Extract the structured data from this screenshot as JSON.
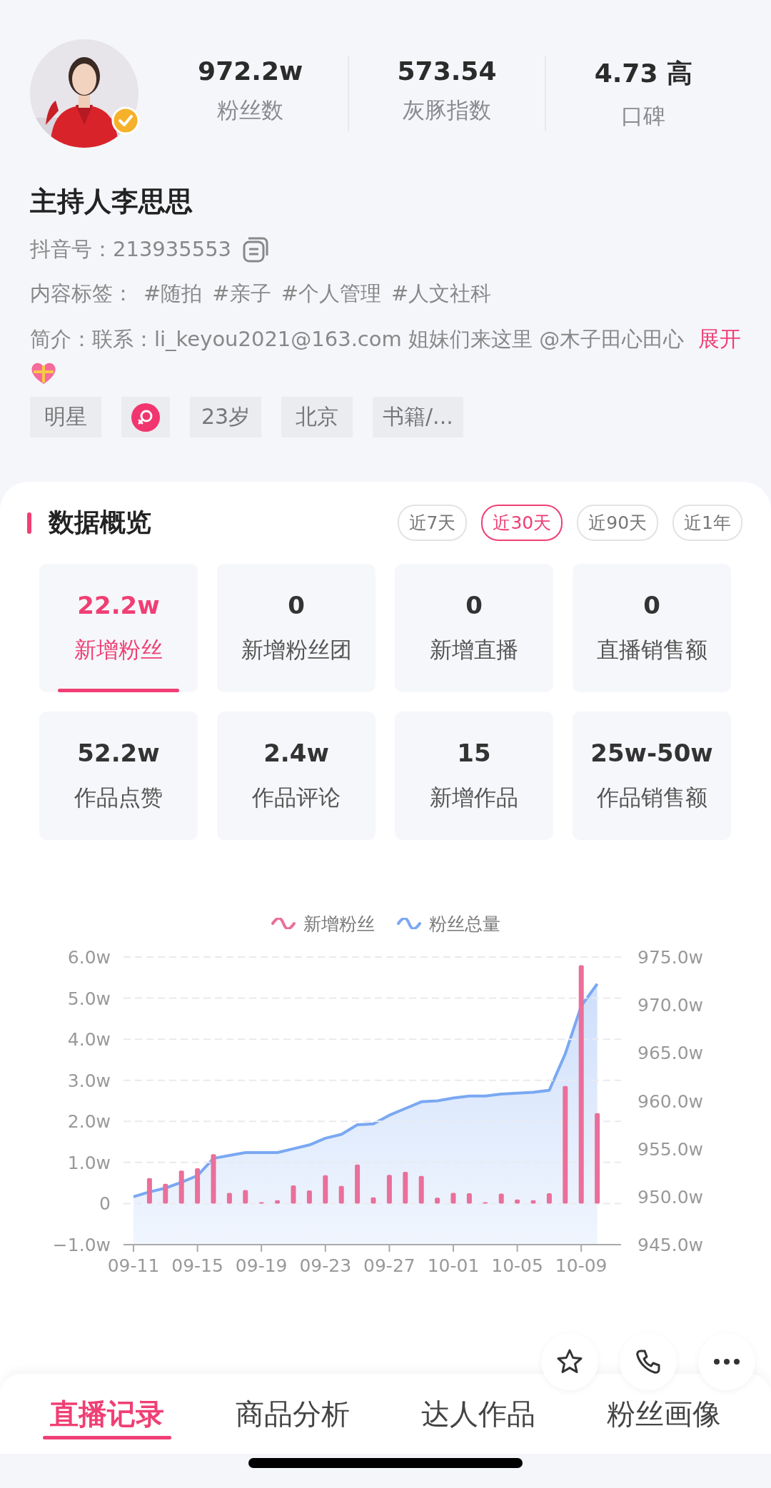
{
  "profile": {
    "stats": [
      {
        "value": "972.2w",
        "label": "粉丝数"
      },
      {
        "value": "573.54",
        "label": "灰豚指数"
      },
      {
        "value": "4.73 高",
        "label": "口碑"
      }
    ],
    "name": "主持人李思思",
    "douyin_id": {
      "label": "抖音号：",
      "value": "213935553"
    },
    "content_tags": {
      "label": "内容标签：",
      "tags": [
        "#随拍",
        "#亲子",
        "#个人管理",
        "#人文社科"
      ]
    },
    "bio": {
      "text": "简介：联系：li_keyou2021@163.com 姐妹们来这里 @木子田心田心",
      "expand": "展开"
    },
    "chips": [
      {
        "kind": "text",
        "label": "明星"
      },
      {
        "kind": "gender"
      },
      {
        "kind": "text",
        "label": "23岁"
      },
      {
        "kind": "text",
        "label": "北京"
      },
      {
        "kind": "text",
        "label": "书籍/..."
      }
    ]
  },
  "overview": {
    "title": "数据概览",
    "periods": [
      {
        "label": "近7天",
        "selected": false
      },
      {
        "label": "近30天",
        "selected": true
      },
      {
        "label": "近90天",
        "selected": false
      },
      {
        "label": "近1年",
        "selected": false
      }
    ],
    "metrics": [
      {
        "value": "22.2w",
        "label": "新增粉丝",
        "selected": true
      },
      {
        "value": "0",
        "label": "新增粉丝团",
        "selected": false
      },
      {
        "value": "0",
        "label": "新增直播",
        "selected": false
      },
      {
        "value": "0",
        "label": "直播销售额",
        "selected": false
      },
      {
        "value": "52.2w",
        "label": "作品点赞",
        "selected": false
      },
      {
        "value": "2.4w",
        "label": "作品评论",
        "selected": false
      },
      {
        "value": "15",
        "label": "新增作品",
        "selected": false
      },
      {
        "value": "25w-50w",
        "label": "作品销售额",
        "selected": false
      }
    ],
    "chart_layers": [
      {
        "chart_data": {
          "type": "bar",
          "categories": [
            "09-11",
            null,
            null,
            null,
            "09-15",
            null,
            null,
            null,
            "09-19",
            null,
            null,
            null,
            "09-23",
            null,
            null,
            null,
            "09-27",
            null,
            null,
            null,
            "10-01",
            null,
            null,
            null,
            "10-05",
            null,
            null,
            null,
            "10-09",
            null
          ],
          "grid": true,
          "legend": true,
          "ylim": [
            -1,
            6
          ],
          "yticks": [
            {
              "value": 6,
              "label": "6.0w"
            },
            {
              "value": 5,
              "label": "5.0w"
            },
            {
              "value": 4,
              "label": "4.0w"
            },
            {
              "value": 3,
              "label": "3.0w"
            },
            {
              "value": 2,
              "label": "2.0w"
            },
            {
              "value": 1,
              "label": "1.0w"
            },
            {
              "value": 0,
              "label": "0"
            },
            {
              "value": -1,
              "label": "−1.0w"
            }
          ],
          "series": [
            {
              "name": "新增粉丝",
              "color": "#ea6f9a",
              "values": [
                null,
                0.62,
                0.48,
                0.8,
                0.86,
                1.2,
                0.26,
                0.33,
                0,
                0.08,
                0.44,
                0.32,
                0.69,
                0.43,
                0.95,
                0.15,
                0.7,
                0.77,
                0.67,
                0.14,
                0.26,
                0.25,
                0.03,
                0.24,
                0.1,
                0.08,
                0.25,
                2.86,
                5.8,
                2.2
              ]
            }
          ]
        }
      },
      {
        "chart_data": {
          "type": "area",
          "legend": true,
          "ylim": [
            945,
            975
          ],
          "yticks": [
            {
              "value": 975,
              "label": "975.0w"
            },
            {
              "value": 970,
              "label": "970.0w"
            },
            {
              "value": 965,
              "label": "965.0w"
            },
            {
              "value": 960,
              "label": "960.0w"
            },
            {
              "value": 955,
              "label": "955.0w"
            },
            {
              "value": 950,
              "label": "950.0w"
            },
            {
              "value": 945,
              "label": "945.0w"
            }
          ],
          "series": [
            {
              "name": "粉丝总量",
              "color": "#7aa8f2",
              "values": [
                950.0,
                950.5,
                950.9,
                951.5,
                952.2,
                954.0,
                954.3,
                954.6,
                954.6,
                954.6,
                955.0,
                955.4,
                956.1,
                956.5,
                957.5,
                957.6,
                958.5,
                959.2,
                959.9,
                960.0,
                960.3,
                960.5,
                960.5,
                960.7,
                960.8,
                960.9,
                961.1,
                964.9,
                969.9,
                972.2
              ]
            }
          ]
        }
      }
    ]
  },
  "tabs": [
    {
      "label": "直播记录",
      "selected": true
    },
    {
      "label": "商品分析",
      "selected": false
    },
    {
      "label": "达人作品",
      "selected": false
    },
    {
      "label": "粉丝画像",
      "selected": false
    }
  ]
}
